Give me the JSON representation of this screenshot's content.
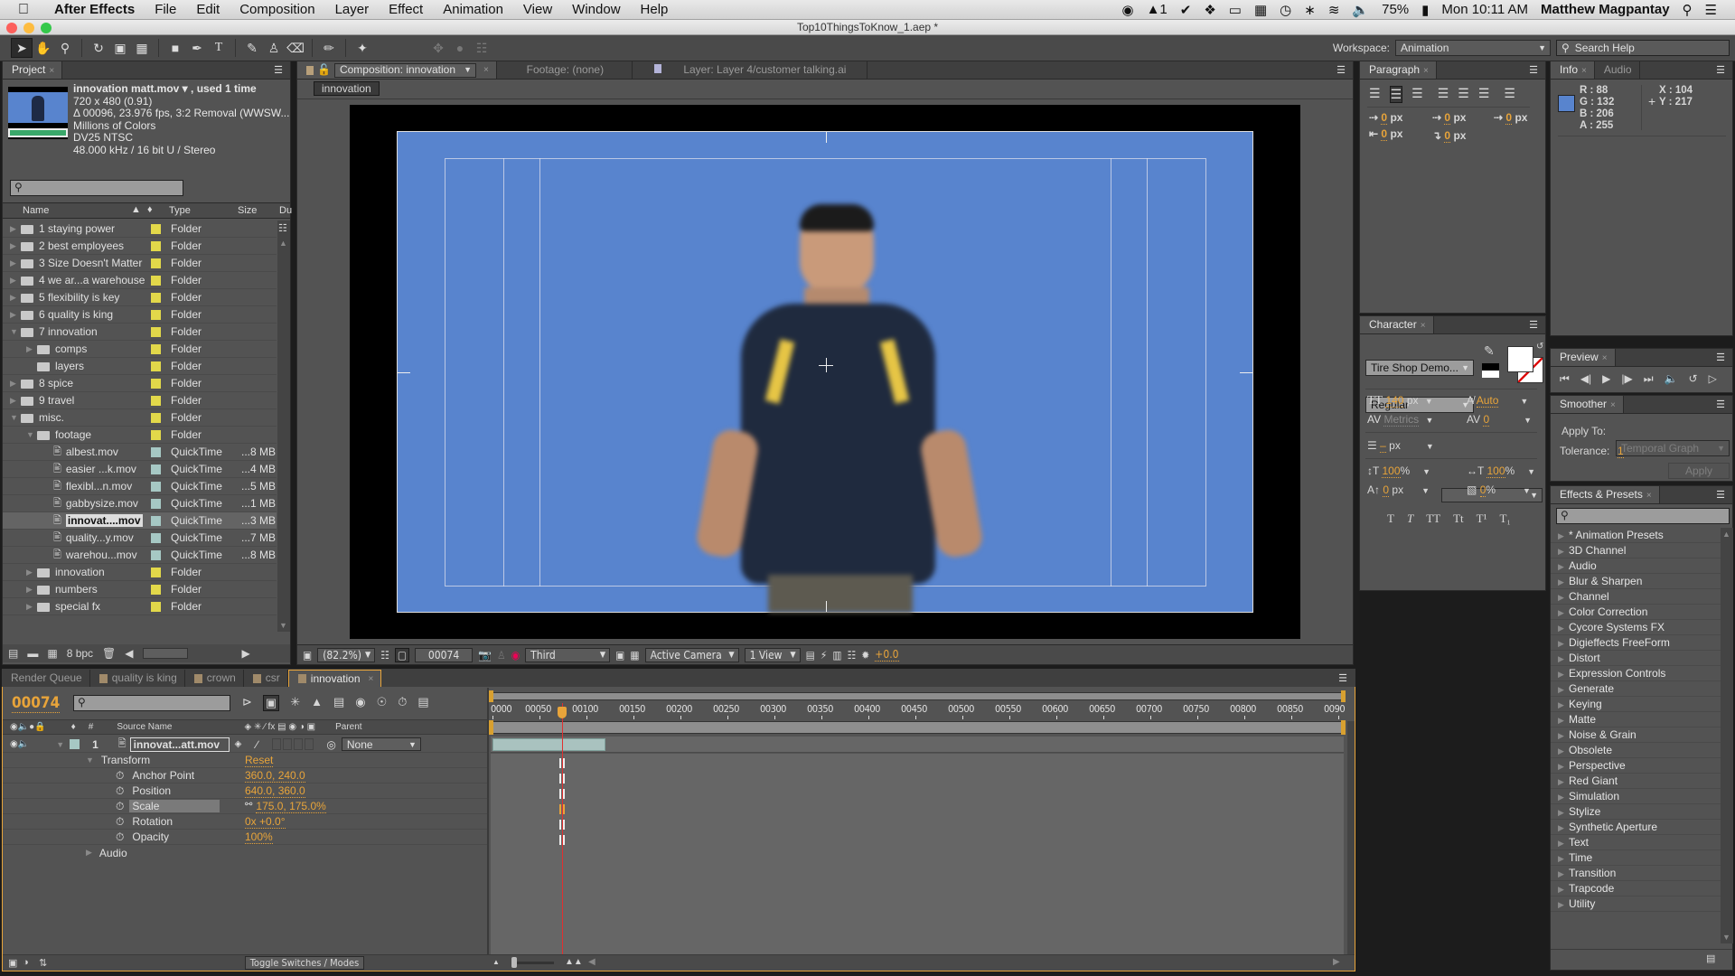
{
  "menubar": {
    "app_name": "After Effects",
    "items": [
      "File",
      "Edit",
      "Composition",
      "Layer",
      "Effect",
      "Animation",
      "View",
      "Window",
      "Help"
    ],
    "status": {
      "battery": "75%",
      "clock": "Mon 10:11 AM",
      "user": "Matthew Magpantay",
      "adobe_badge": "1"
    }
  },
  "window": {
    "title": "Top10ThingsToKnow_1.aep *"
  },
  "workspace": {
    "label": "Workspace:",
    "value": "Animation",
    "search_placeholder": "Search Help"
  },
  "project": {
    "tab": "Project",
    "footage_info": {
      "name": "innovation matt.mov ▾ , used 1 time",
      "dims": "720 x 480 (0.91)",
      "duration": "Δ 00096, 23.976 fps, 3:2 Removal (WWSW...",
      "colors": "Millions of Colors",
      "codec": "DV25 NTSC",
      "audio": "48.000 kHz / 16 bit U / Stereo"
    },
    "search_placeholder": "",
    "columns": {
      "name": "Name",
      "type": "Type",
      "size": "Size",
      "duration": "Du"
    },
    "items": [
      {
        "name": "1 staying power",
        "type": "Folder",
        "size": "",
        "kind": "folder",
        "depth": 0,
        "expand": "closed",
        "label": "#e2d84a"
      },
      {
        "name": "2 best employees",
        "type": "Folder",
        "size": "",
        "kind": "folder",
        "depth": 0,
        "expand": "closed",
        "label": "#e2d84a"
      },
      {
        "name": "3 Size Doesn't Matter",
        "type": "Folder",
        "size": "",
        "kind": "folder",
        "depth": 0,
        "expand": "closed",
        "label": "#e2d84a"
      },
      {
        "name": "4 we ar...a warehouse",
        "type": "Folder",
        "size": "",
        "kind": "folder",
        "depth": 0,
        "expand": "closed",
        "label": "#e2d84a"
      },
      {
        "name": "5 flexibility is key",
        "type": "Folder",
        "size": "",
        "kind": "folder",
        "depth": 0,
        "expand": "closed",
        "label": "#e2d84a"
      },
      {
        "name": "6 quality is king",
        "type": "Folder",
        "size": "",
        "kind": "folder",
        "depth": 0,
        "expand": "closed",
        "label": "#e2d84a"
      },
      {
        "name": "7 innovation",
        "type": "Folder",
        "size": "",
        "kind": "folder",
        "depth": 0,
        "expand": "open",
        "label": "#e2d84a"
      },
      {
        "name": "comps",
        "type": "Folder",
        "size": "",
        "kind": "folder",
        "depth": 1,
        "expand": "closed",
        "label": "#e2d84a"
      },
      {
        "name": "layers",
        "type": "Folder",
        "size": "",
        "kind": "folder",
        "depth": 1,
        "expand": "none",
        "label": "#e2d84a"
      },
      {
        "name": "8 spice",
        "type": "Folder",
        "size": "",
        "kind": "folder",
        "depth": 0,
        "expand": "closed",
        "label": "#e2d84a"
      },
      {
        "name": "9 travel",
        "type": "Folder",
        "size": "",
        "kind": "folder",
        "depth": 0,
        "expand": "closed",
        "label": "#e2d84a"
      },
      {
        "name": "misc.",
        "type": "Folder",
        "size": "",
        "kind": "folder",
        "depth": 0,
        "expand": "open",
        "label": "#e2d84a"
      },
      {
        "name": "footage",
        "type": "Folder",
        "size": "",
        "kind": "folder",
        "depth": 1,
        "expand": "open",
        "label": "#e2d84a"
      },
      {
        "name": "albest.mov",
        "type": "QuickTime",
        "size": "...8 MB",
        "kind": "file",
        "depth": 2,
        "expand": "none",
        "label": "#a6c8c4"
      },
      {
        "name": "easier ...k.mov",
        "type": "QuickTime",
        "size": "...4 MB",
        "kind": "file",
        "depth": 2,
        "expand": "none",
        "label": "#a6c8c4"
      },
      {
        "name": "flexibl...n.mov",
        "type": "QuickTime",
        "size": "...5 MB",
        "kind": "file",
        "depth": 2,
        "expand": "none",
        "label": "#a6c8c4"
      },
      {
        "name": "gabbysize.mov",
        "type": "QuickTime",
        "size": "...1 MB",
        "kind": "file",
        "depth": 2,
        "expand": "none",
        "label": "#a6c8c4"
      },
      {
        "name": "innovat....mov",
        "type": "QuickTime",
        "size": "...3 MB",
        "kind": "file",
        "depth": 2,
        "expand": "none",
        "label": "#a6c8c4",
        "selected": true
      },
      {
        "name": "quality...y.mov",
        "type": "QuickTime",
        "size": "...7 MB",
        "kind": "file",
        "depth": 2,
        "expand": "none",
        "label": "#a6c8c4"
      },
      {
        "name": "warehou...mov",
        "type": "QuickTime",
        "size": "...8 MB",
        "kind": "file",
        "depth": 2,
        "expand": "none",
        "label": "#a6c8c4"
      },
      {
        "name": "innovation",
        "type": "Folder",
        "size": "",
        "kind": "folder",
        "depth": 1,
        "expand": "closed",
        "label": "#e2d84a"
      },
      {
        "name": "numbers",
        "type": "Folder",
        "size": "",
        "kind": "folder",
        "depth": 1,
        "expand": "closed",
        "label": "#e2d84a"
      },
      {
        "name": "special fx",
        "type": "Folder",
        "size": "",
        "kind": "folder",
        "depth": 1,
        "expand": "closed",
        "label": "#e2d84a"
      }
    ],
    "bpc": "8 bpc"
  },
  "viewer": {
    "tabs": [
      {
        "label": "Composition: innovation",
        "active": true
      },
      {
        "label": "Footage: (none)",
        "active": false
      },
      {
        "label": "Layer: Layer 4/customer talking.ai",
        "active": false
      }
    ],
    "comp_breadcrumb": "innovation",
    "bottom": {
      "zoom": "(82.2%)",
      "timecode": "00074",
      "resolution": "Third",
      "camera": "Active Camera",
      "views": "1 View",
      "exposure": "+0.0"
    },
    "background_color": "#5884ce"
  },
  "paragraph": {
    "tab": "Paragraph",
    "indents": [
      {
        "name": "indent-left",
        "value": "0",
        "unit": "px"
      },
      {
        "name": "indent-first-line",
        "value": "0",
        "unit": "px"
      },
      {
        "name": "indent-right",
        "value": "0",
        "unit": "px"
      },
      {
        "name": "space-before",
        "value": "0",
        "unit": "px"
      },
      {
        "name": "space-after",
        "value": "0",
        "unit": "px"
      }
    ]
  },
  "info": {
    "tabs": [
      "Info",
      "Audio"
    ],
    "r": "R : 88",
    "g": "G : 132",
    "b": "B : 206",
    "a": "A : 255",
    "x": "X : 104",
    "y": "Y : 217",
    "swatch": "#5884ce"
  },
  "character": {
    "tab": "Character",
    "font": "Tire Shop Demo...",
    "style": "Regular",
    "size": "140",
    "size_unit": "px",
    "leading": "Auto",
    "kerning": "Metrics",
    "tracking": "0",
    "stroke": "–",
    "stroke_unit": "px",
    "vscale": "100",
    "hscale": "100",
    "baseline": "0",
    "baseline_unit": "px",
    "tsume": "0",
    "pct": "%",
    "styles": [
      "T",
      "T",
      "TT",
      "Tt",
      "T¹",
      "T₁"
    ]
  },
  "preview": {
    "tab": "Preview"
  },
  "smoother": {
    "tab": "Smoother",
    "apply_to_label": "Apply To:",
    "apply_to_value": "Temporal Graph",
    "tolerance_label": "Tolerance:",
    "tolerance_value": "1",
    "apply_button": "Apply"
  },
  "effects": {
    "tab": "Effects & Presets",
    "items": [
      "* Animation Presets",
      "3D Channel",
      "Audio",
      "Blur & Sharpen",
      "Channel",
      "Color Correction",
      "Cycore Systems FX",
      "Digieffects FreeForm",
      "Distort",
      "Expression Controls",
      "Generate",
      "Keying",
      "Matte",
      "Noise & Grain",
      "Obsolete",
      "Perspective",
      "Red Giant",
      "Simulation",
      "Stylize",
      "Synthetic Aperture",
      "Text",
      "Time",
      "Transition",
      "Trapcode",
      "Utility"
    ]
  },
  "timeline": {
    "tabs": [
      {
        "label": "Render Queue",
        "swatch": false,
        "active": false
      },
      {
        "label": "quality is king",
        "swatch": true,
        "active": false
      },
      {
        "label": "crown",
        "swatch": true,
        "active": false
      },
      {
        "label": "csr",
        "swatch": true,
        "active": false
      },
      {
        "label": "innovation",
        "swatch": true,
        "active": true
      }
    ],
    "current_time": "00074",
    "columns": {
      "num": "#",
      "source": "Source Name",
      "parent": "Parent"
    },
    "layer": {
      "index": "1",
      "name": "innovat...att.mov",
      "parent": "None"
    },
    "transform": {
      "label": "Transform",
      "reset": "Reset",
      "props": [
        {
          "name": "Anchor Point",
          "value": "360.0, 240.0"
        },
        {
          "name": "Position",
          "value": "640.0, 360.0"
        },
        {
          "name": "Scale",
          "value": "175.0, 175.0%",
          "selected": true
        },
        {
          "name": "Rotation",
          "value": "0x +0.0°"
        },
        {
          "name": "Opacity",
          "value": "100%"
        }
      ]
    },
    "audio_label": "Audio",
    "ruler_ticks": [
      "0000",
      "00050",
      "00100",
      "00150",
      "00200",
      "00250",
      "00300",
      "00350",
      "00400",
      "00450",
      "00500",
      "00550",
      "00600",
      "00650",
      "00700",
      "00750",
      "00800",
      "00850",
      "0090"
    ],
    "playhead_frame": 74,
    "layer_bar_end_frame": 120,
    "toggle_label": "Toggle Switches / Modes"
  }
}
